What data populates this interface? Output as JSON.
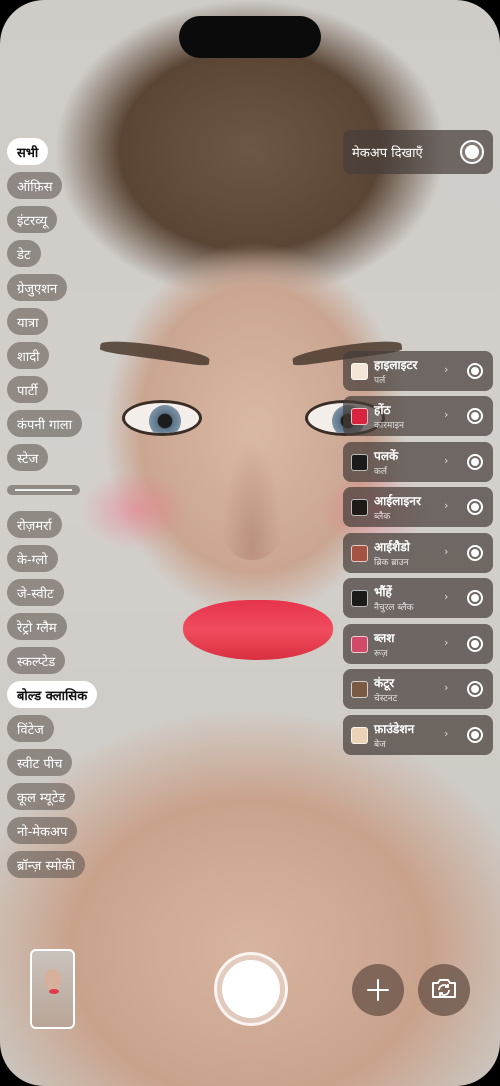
{
  "filters": [
    {
      "label": "सभी",
      "active": true
    },
    {
      "label": "ऑफ़िस",
      "active": false
    },
    {
      "label": "इंटरव्यू",
      "active": false
    },
    {
      "label": "डेट",
      "active": false
    },
    {
      "label": "ग्रेजुएशन",
      "active": false
    },
    {
      "label": "यात्रा",
      "active": false
    },
    {
      "label": "शादी",
      "active": false
    },
    {
      "label": "पार्टी",
      "active": false
    },
    {
      "label": "कंपनी गाला",
      "active": false
    },
    {
      "label": "स्टेज",
      "active": false
    }
  ],
  "looks": [
    {
      "label": "रोज़मर्रा",
      "active": false
    },
    {
      "label": "के-ग्लो",
      "active": false
    },
    {
      "label": "जे-स्वीट",
      "active": false
    },
    {
      "label": "रेट्रो ग्लैम",
      "active": false
    },
    {
      "label": "स्कल्प्टेड",
      "active": false
    },
    {
      "label": "बोल्ड क्लासिक",
      "active": true
    },
    {
      "label": "विंटेज",
      "active": false
    },
    {
      "label": "स्वीट पीच",
      "active": false
    },
    {
      "label": "कूल म्यूटेड",
      "active": false
    },
    {
      "label": "नो-मेकअप",
      "active": false
    },
    {
      "label": "ब्रॉन्ज़ स्मोकी",
      "active": false
    }
  ],
  "makeup_toggle": {
    "label": "मेकअप दिखाएँ",
    "on": true
  },
  "products": [
    {
      "name": "हाइलाइटर",
      "shade": "पर्ल",
      "color": "#f3e6d6",
      "on": true
    },
    {
      "name": "होंठ",
      "shade": "कारमाइन",
      "color": "#d8243f",
      "on": true
    },
    {
      "name": "पलकें",
      "shade": "कर्ल",
      "color": "#1b1b1b",
      "on": true
    },
    {
      "name": "आईलाइनर",
      "shade": "ब्लैक",
      "color": "#1f1a18",
      "on": true
    },
    {
      "name": "आईशैडो",
      "shade": "ब्रिक ब्राउन",
      "color": "#a3533f",
      "on": true
    },
    {
      "name": "भौंहें",
      "shade": "नैचुरल ब्लैक",
      "color": "#1c1a18",
      "on": true
    },
    {
      "name": "ब्लश",
      "shade": "रूज़",
      "color": "#d24a6a",
      "on": true
    },
    {
      "name": "कंटूर",
      "shade": "चेस्टनट",
      "color": "#7b5a45",
      "on": true
    },
    {
      "name": "फ़ाउंडेशन",
      "shade": "बेज",
      "color": "#ecd2b6",
      "on": true
    }
  ],
  "icons": {
    "chevron": "chevron-right-icon",
    "add": "plus-icon",
    "flip_camera": "camera-flip-icon"
  },
  "colors": {
    "accent_active_chip": "#ffffff",
    "panel_bg": "#463e3a"
  }
}
